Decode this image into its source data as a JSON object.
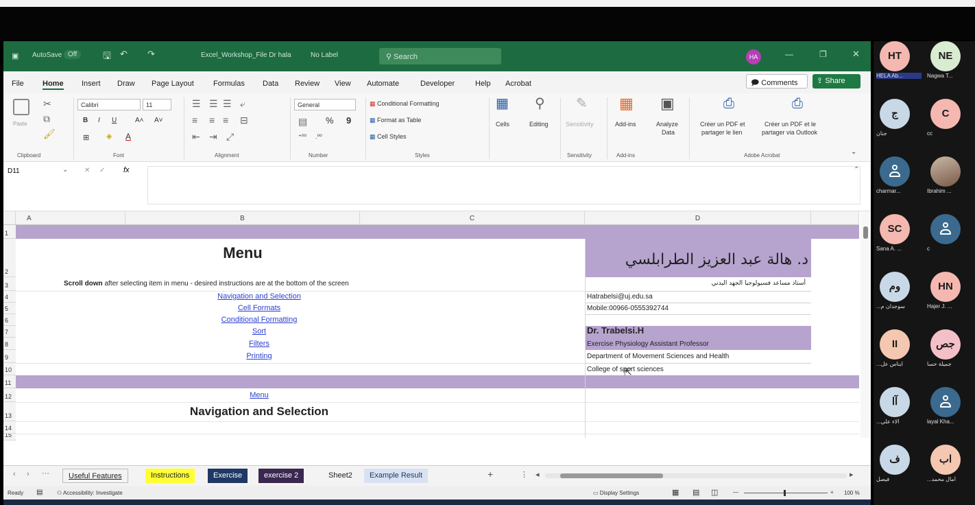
{
  "window": {
    "autosave_label": "AutoSave",
    "autosave_state": "Off",
    "file_title": "Excel_Workshop_File Dr hala",
    "label_status": "No Label",
    "search_placeholder": "Search",
    "user_initials": "HA"
  },
  "menu": {
    "items": [
      "File",
      "Home",
      "Insert",
      "Draw",
      "Page Layout",
      "Formulas",
      "Data",
      "Review",
      "View",
      "Automate",
      "Developer",
      "Help",
      "Acrobat"
    ],
    "active": "Home",
    "comments_label": "Comments",
    "share_label": "Share"
  },
  "ribbon": {
    "clipboard": {
      "paste": "Paste",
      "group": "Clipboard"
    },
    "font": {
      "name": "Calibri",
      "size": "11",
      "group": "Font"
    },
    "alignment": {
      "group": "Alignment"
    },
    "number": {
      "format": "General",
      "percent": "%",
      "comma": "9",
      "group": "Number"
    },
    "styles": {
      "conditional": "Conditional Formatting",
      "format_table": "Format as Table",
      "cell_styles": "Cell Styles",
      "group": "Styles"
    },
    "cells": {
      "label": "Cells"
    },
    "editing": {
      "label": "Editing"
    },
    "sensitivity": {
      "label": "Sensitivity",
      "group": "Sensitivity"
    },
    "addins": {
      "label": "Add-ins",
      "group": "Add-ins"
    },
    "analyze": {
      "label1": "Analyze",
      "label2": "Data"
    },
    "acrobat": {
      "pdf_share1": "Créer un PDF et",
      "pdf_share2": "partager le lien",
      "pdf_outlook1": "Créer un PDF et le",
      "pdf_outlook2": "partager via Outlook",
      "group": "Adobe Acrobat"
    }
  },
  "formula_bar": {
    "name_box": "D11",
    "fx": "fx",
    "value": ""
  },
  "grid": {
    "columns": [
      "A",
      "B",
      "C",
      "D"
    ],
    "rows": [
      "1",
      "2",
      "3",
      "4",
      "5",
      "6",
      "7",
      "8",
      "9",
      "10",
      "11",
      "12",
      "13",
      "14",
      "15"
    ],
    "menu_title": "Menu",
    "scroll_bold": "Scroll down",
    "scroll_rest": " after selecting item in menu - desired instructions are at the bottom of the screen",
    "links": [
      "Navigation and Selection",
      "Cell Formats",
      "Conditional Formatting",
      "Sort",
      "Filters",
      "Printing"
    ],
    "menu_link": "Menu",
    "section_title": "Navigation and Selection",
    "arabic_name": "د. هالة عبد العزيز الطرابلسي",
    "arabic_title": "أستاذ مساعد فسيولوجيا الجهد البدني",
    "email": "Hatrabelsi@uj.edu.sa",
    "mobile": "Mobile:00966-0555392744",
    "doctor": "Dr. Trabelsi.H",
    "position": "Exercise Physiology Assistant Professor",
    "department": "Department of Movement Sciences and Health",
    "college": "College of sport sciences"
  },
  "sheet_tabs": [
    {
      "label": "Useful Features",
      "bg": "#f3f3f3",
      "color": "#222"
    },
    {
      "label": "Instructions",
      "bg": "#ffff33",
      "color": "#222"
    },
    {
      "label": "Exercise",
      "bg": "#1f3864",
      "color": "#ffffff"
    },
    {
      "label": "exercise 2",
      "bg": "#3a2850",
      "color": "#ffffff"
    },
    {
      "label": "Sheet2",
      "bg": "#f3f3f3",
      "color": "#222"
    },
    {
      "label": "Example Result",
      "bg": "#d9e2f3",
      "color": "#1f3864"
    }
  ],
  "status": {
    "ready": "Ready",
    "accessibility": "Accessibility: Investigate",
    "display": "Display Settings",
    "zoom": "100 %"
  },
  "participants": [
    {
      "initials": "HT",
      "name": "HELA Ab...",
      "bg": "#f4b8b0"
    },
    {
      "initials": "NE",
      "name": "Nagwa T...",
      "bg": "#d9ebd0"
    },
    {
      "initials": "ج",
      "name": "جنان",
      "bg": "#c9d8e6"
    },
    {
      "initials": "C",
      "name": "cc",
      "bg": "#f4b8b0"
    },
    {
      "initials": "",
      "name": "charmar...",
      "bg": "#3b6a8e"
    },
    {
      "initials": "",
      "name": "Ibrahim ...",
      "bg": "#9a8a7a"
    },
    {
      "initials": "SC",
      "name": "Sana A. ...",
      "bg": "#f4b8b0"
    },
    {
      "initials": "",
      "name": "c",
      "bg": "#3b6a8e"
    },
    {
      "initials": "وم",
      "name": "...سوجدان م",
      "bg": "#c9d8e6"
    },
    {
      "initials": "HN",
      "name": "Hajer J. ...",
      "bg": "#f4b8b0"
    },
    {
      "initials": "II",
      "name": "...ايناس عل",
      "bg": "#f4c7b0"
    },
    {
      "initials": "جص",
      "name": "جميلة حسا",
      "bg": "#f4c0c8"
    },
    {
      "initials": "آا",
      "name": "...آلاء علي",
      "bg": "#c9d8e6"
    },
    {
      "initials": "",
      "name": "layal Kha...",
      "bg": "#3b6a8e"
    },
    {
      "initials": "ف",
      "name": "فيصل",
      "bg": "#c9d8e6"
    },
    {
      "initials": "اب",
      "name": "...آمال محمد",
      "bg": "#f4c7b0"
    }
  ]
}
